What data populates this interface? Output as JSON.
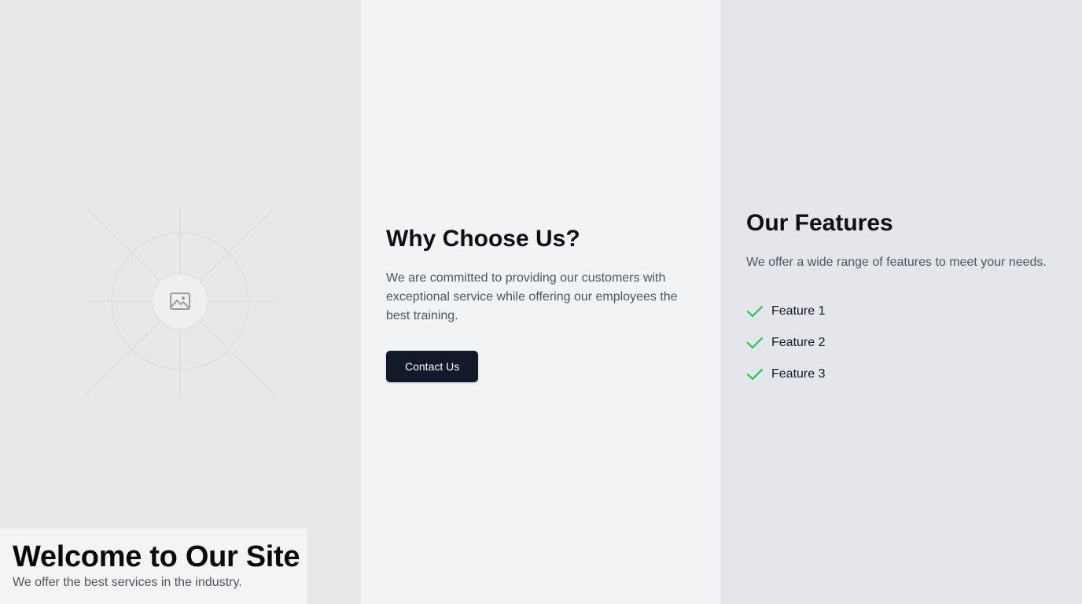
{
  "hero": {
    "title": "Welcome to Our Site",
    "subtitle": "We offer the best services in the industry.",
    "image_icon": "image-placeholder-icon"
  },
  "why": {
    "heading": "Why Choose Us?",
    "body": "We are committed to providing our customers with exceptional service while offering our employees the best training.",
    "button_label": "Contact Us"
  },
  "features": {
    "heading": "Our Features",
    "intro": "We offer a wide range of features to meet your needs.",
    "items": [
      {
        "label": "Feature 1",
        "icon": "check-icon"
      },
      {
        "label": "Feature 2",
        "icon": "check-icon"
      },
      {
        "label": "Feature 3",
        "icon": "check-icon"
      }
    ]
  },
  "colors": {
    "left_panel": "#e8e8e8",
    "middle_panel": "#f2f3f5",
    "right_panel": "#e5e6e9",
    "button_bg": "#111827",
    "check": "#22c55e"
  }
}
